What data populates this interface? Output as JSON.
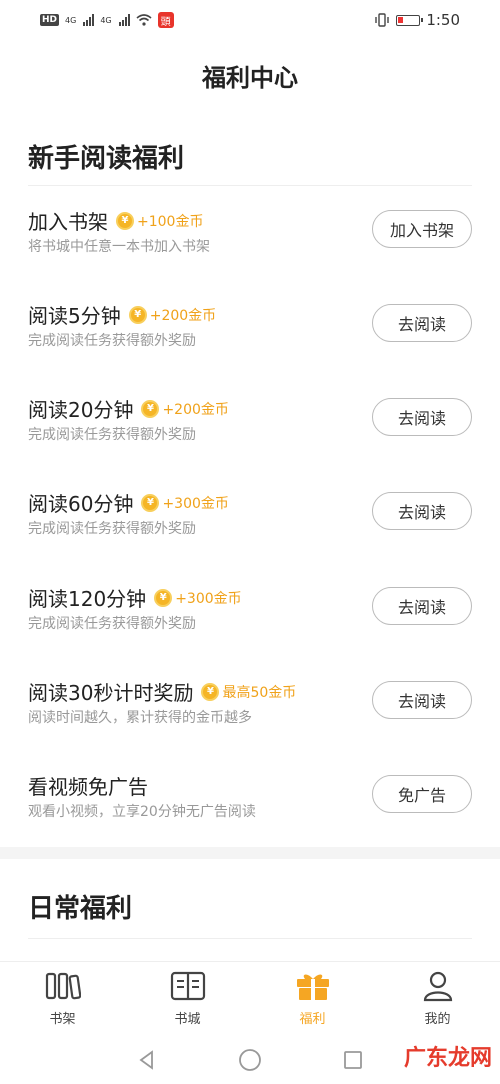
{
  "status": {
    "time": "1:50",
    "hd": "HD",
    "net1": "4G",
    "net2": "4G",
    "app_badge": "頭"
  },
  "page_title": "福利中心",
  "newbie": {
    "title": "新手阅读福利",
    "tasks": [
      {
        "name": "加入书架",
        "reward": "+100金币",
        "desc": "将书城中任意一本书加入书架",
        "button": "加入书架"
      },
      {
        "name": "阅读5分钟",
        "reward": "+200金币",
        "desc": "完成阅读任务获得额外奖励",
        "button": "去阅读"
      },
      {
        "name": "阅读20分钟",
        "reward": "+200金币",
        "desc": "完成阅读任务获得额外奖励",
        "button": "去阅读"
      },
      {
        "name": "阅读60分钟",
        "reward": "+300金币",
        "desc": "完成阅读任务获得额外奖励",
        "button": "去阅读"
      },
      {
        "name": "阅读120分钟",
        "reward": "+300金币",
        "desc": "完成阅读任务获得额外奖励",
        "button": "去阅读"
      },
      {
        "name": "阅读30秒计时奖励",
        "reward": "最高50金币",
        "desc": "阅读时间越久，累计获得的金币越多",
        "button": "去阅读"
      },
      {
        "name": "看视频免广告",
        "reward": "",
        "desc": "观看小视频，立享20分钟无广告阅读",
        "button": "免广告"
      }
    ]
  },
  "daily": {
    "title": "日常福利"
  },
  "tabs": [
    {
      "label": "书架",
      "icon": "bookshelf-icon"
    },
    {
      "label": "书城",
      "icon": "book-icon"
    },
    {
      "label": "福利",
      "icon": "gift-icon",
      "active": true
    },
    {
      "label": "我的",
      "icon": "user-icon"
    }
  ],
  "watermark": "广东龙网",
  "colors": {
    "accent": "#f5a623",
    "reward": "#f0a21a",
    "coin": "#f5b526"
  }
}
